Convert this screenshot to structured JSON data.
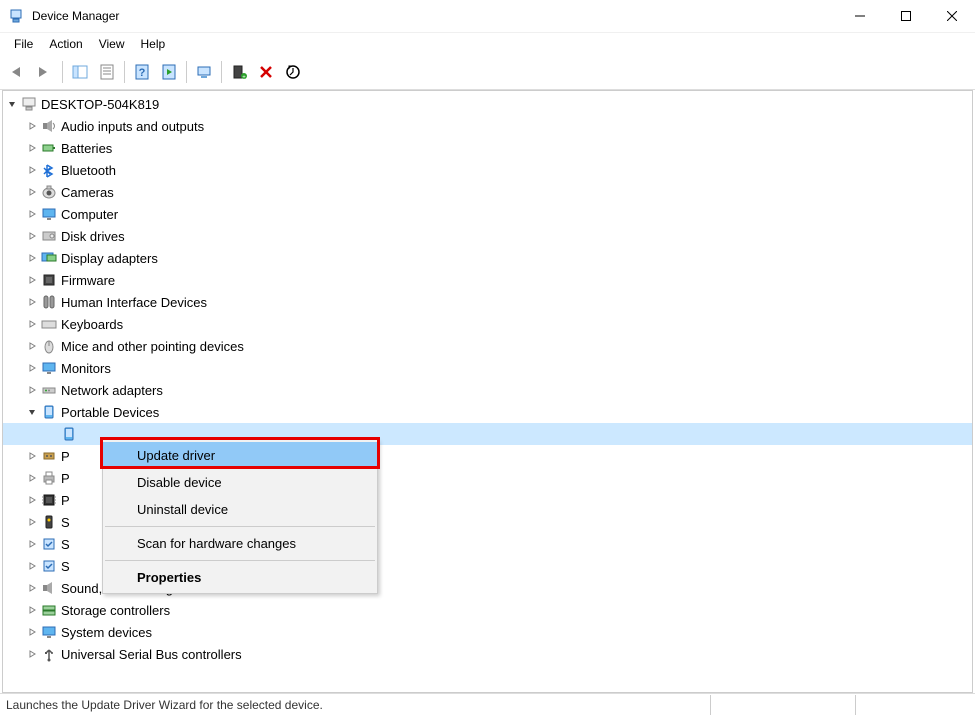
{
  "window": {
    "title": "Device Manager",
    "minimize": "–",
    "maximize": "☐",
    "close": "✕"
  },
  "menubar": [
    "File",
    "Action",
    "View",
    "Help"
  ],
  "root_name": "DESKTOP-504K819",
  "categories": [
    {
      "label": "Audio inputs and outputs",
      "icon": "speaker",
      "expanded": false
    },
    {
      "label": "Batteries",
      "icon": "battery",
      "expanded": false
    },
    {
      "label": "Bluetooth",
      "icon": "bluetooth",
      "expanded": false
    },
    {
      "label": "Cameras",
      "icon": "camera",
      "expanded": false
    },
    {
      "label": "Computer",
      "icon": "monitor",
      "expanded": false
    },
    {
      "label": "Disk drives",
      "icon": "disk",
      "expanded": false
    },
    {
      "label": "Display adapters",
      "icon": "display",
      "expanded": false
    },
    {
      "label": "Firmware",
      "icon": "chip",
      "expanded": false
    },
    {
      "label": "Human Interface Devices",
      "icon": "hid",
      "expanded": false
    },
    {
      "label": "Keyboards",
      "icon": "keyboard",
      "expanded": false
    },
    {
      "label": "Mice and other pointing devices",
      "icon": "mouse",
      "expanded": false
    },
    {
      "label": "Monitors",
      "icon": "monitor",
      "expanded": false
    },
    {
      "label": "Network adapters",
      "icon": "network",
      "expanded": false
    },
    {
      "label": "Portable Devices",
      "icon": "portable",
      "expanded": true,
      "children": [
        {
          "label": "",
          "icon": "portable",
          "selected": true
        }
      ]
    },
    {
      "label": "P",
      "icon": "port",
      "expanded": false,
      "truncated": true
    },
    {
      "label": "P",
      "icon": "printer",
      "expanded": false,
      "truncated": true
    },
    {
      "label": "P",
      "icon": "processor",
      "expanded": false,
      "truncated": true
    },
    {
      "label": "S",
      "icon": "security",
      "expanded": false,
      "truncated": true
    },
    {
      "label": "S",
      "icon": "software",
      "expanded": false,
      "truncated": true
    },
    {
      "label": "S",
      "icon": "software",
      "expanded": false,
      "truncated": true
    },
    {
      "label": "Sound, video and game controllers",
      "icon": "sound",
      "expanded": false,
      "truncated_visual": true
    },
    {
      "label": "Storage controllers",
      "icon": "storage",
      "expanded": false
    },
    {
      "label": "System devices",
      "icon": "system",
      "expanded": false
    },
    {
      "label": "Universal Serial Bus controllers",
      "icon": "usb",
      "expanded": false
    }
  ],
  "context_menu": {
    "items": [
      {
        "label": "Update driver",
        "highlighted": true
      },
      {
        "label": "Disable device"
      },
      {
        "label": "Uninstall device"
      },
      {
        "sep": true
      },
      {
        "label": "Scan for hardware changes"
      },
      {
        "sep": true
      },
      {
        "label": "Properties",
        "bold": true
      }
    ]
  },
  "statusbar": {
    "text": "Launches the Update Driver Wizard for the selected device."
  },
  "colors": {
    "highlight": "#91c9f7",
    "highlight_box": "#e60000"
  }
}
